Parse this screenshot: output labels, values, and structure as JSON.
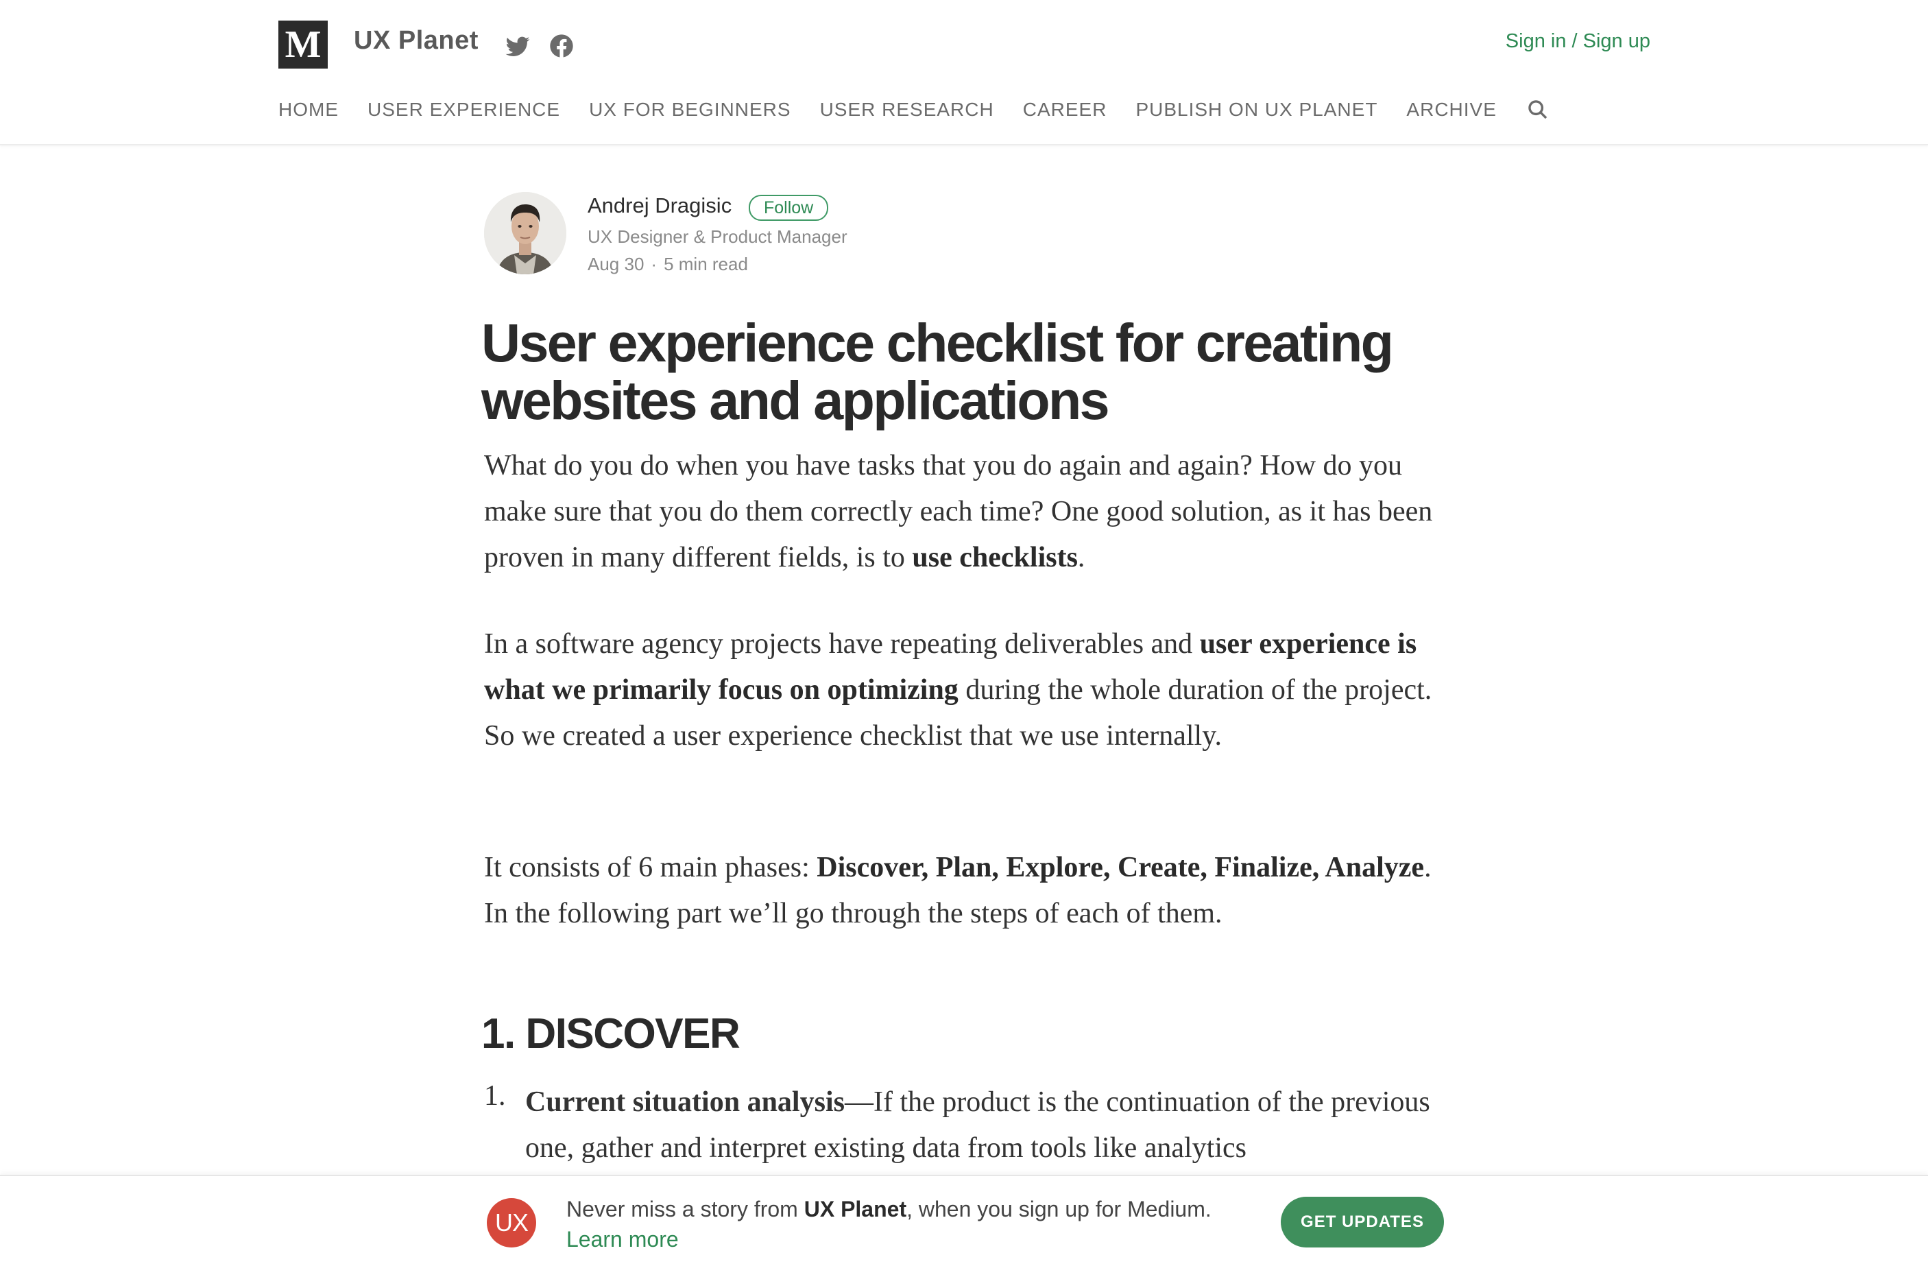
{
  "header": {
    "logo_letter": "M",
    "publication": "UX Planet",
    "social": [
      "twitter-icon",
      "facebook-icon"
    ],
    "signin": "Sign in / Sign up"
  },
  "nav": {
    "items": [
      "HOME",
      "USER EXPERIENCE",
      "UX FOR BEGINNERS",
      "USER RESEARCH",
      "CAREER",
      "PUBLISH ON UX PLANET",
      "ARCHIVE"
    ],
    "search_icon": "search-icon"
  },
  "author": {
    "name": "Andrej Dragisic",
    "follow": "Follow",
    "bio": "UX Designer & Product Manager",
    "date": "Aug 30",
    "separator": "·",
    "read_time": "5 min read"
  },
  "article": {
    "title": "User experience checklist for creating websites and applications",
    "p1": {
      "text": "What do you do when you have tasks that you do again and again? How do you make sure that you do them correctly each time? One good solution, as it has been proven in many different fields, is to ",
      "bold": "use checklists",
      "end": "."
    },
    "p2": {
      "text": "In a software agency projects have repeating deliverables and ",
      "bold": "user experience is what we primarily focus on optimizing",
      "end": " during the whole duration of the project. So we created a user experience checklist that we use internally."
    },
    "p3": {
      "text": "It consists of 6 main phases: ",
      "bold": "Discover, Plan, Explore, Create, Finalize, Analyze",
      "end": ". In the following part we’ll go through the steps of each of them."
    },
    "section_heading": "1. DISCOVER",
    "list": [
      {
        "number": "1.",
        "bold": "Current situation analysis",
        "text": "—If the product is the continuation of the previous one, gather and interpret existing data from tools like analytics"
      }
    ]
  },
  "banner": {
    "badge": "UX",
    "text_before": "Never miss a story from ",
    "publication": "UX Planet",
    "text_after": ", when you sign up for Medium. ",
    "learn_more": "Learn more",
    "button": "GET UPDATES"
  },
  "colors": {
    "accent_green": "#2e8a54",
    "button_green": "#3f8f5c",
    "badge_red": "#d6483b"
  }
}
